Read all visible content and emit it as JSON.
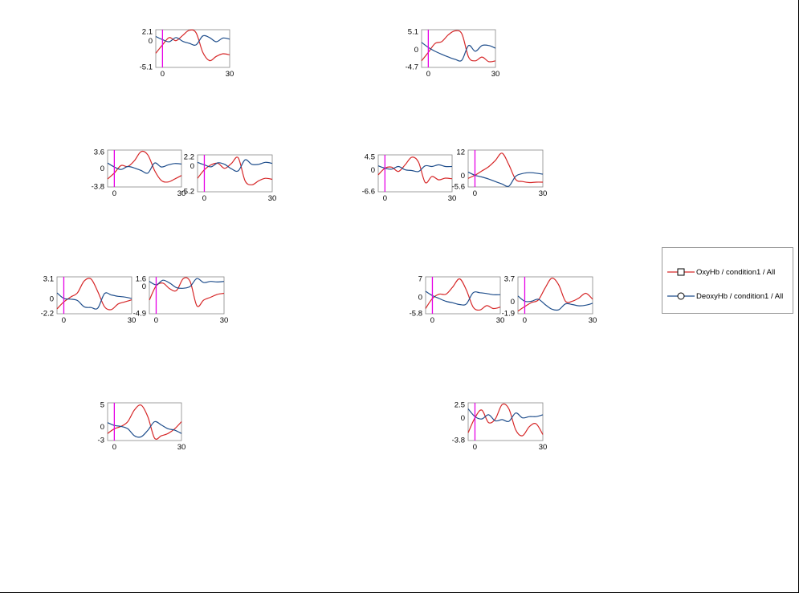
{
  "legend": {
    "placement": "right",
    "items": [
      {
        "label": "OxyHb / condition1 / All",
        "color": "#d62728",
        "marker": "square-icon"
      },
      {
        "label": "DeoxyHb / condition1 / All",
        "color": "#1f4e8c",
        "marker": "circle-icon"
      }
    ]
  },
  "colors": {
    "oxy": "#d62728",
    "deoxy": "#1f4e8c",
    "stim": "#e600e6"
  },
  "chart_data": [
    {
      "type": "line",
      "x_ticks": [
        "0",
        "30"
      ],
      "y_ticks": [
        "2.1",
        "0",
        "-5.1"
      ],
      "xlim": [
        -3,
        30
      ],
      "ylim": [
        -5.1,
        2.1
      ],
      "stim_x": 0,
      "series": [
        {
          "name": "OxyHb / condition1 / All",
          "x": [
            -3,
            0,
            3,
            6,
            9,
            12,
            15,
            18,
            21,
            24,
            27,
            30
          ],
          "y": [
            -2.4,
            -0.8,
            0.6,
            0.0,
            1.0,
            2.0,
            1.5,
            -2.2,
            -3.8,
            -3.0,
            -2.5,
            -2.7
          ]
        },
        {
          "name": "DeoxyHb / condition1 / All",
          "x": [
            -3,
            0,
            3,
            6,
            9,
            12,
            15,
            18,
            21,
            24,
            27,
            30
          ],
          "y": [
            0.8,
            0.2,
            -0.2,
            0.6,
            -0.1,
            -0.5,
            -0.8,
            0.9,
            0.6,
            -0.2,
            0.5,
            0.3
          ]
        }
      ]
    },
    {
      "type": "line",
      "x_ticks": [
        "0",
        "30"
      ],
      "y_ticks": [
        "5.1",
        "0",
        "-4.7"
      ],
      "xlim": [
        -3,
        30
      ],
      "ylim": [
        -4.7,
        5.1
      ],
      "stim_x": 0,
      "series": [
        {
          "name": "OxyHb / condition1 / All",
          "x": [
            -3,
            0,
            3,
            6,
            9,
            12,
            15,
            18,
            21,
            24,
            27,
            30
          ],
          "y": [
            -3.0,
            -0.8,
            1.5,
            2.0,
            3.8,
            4.8,
            4.0,
            -2.0,
            -3.0,
            -2.0,
            -3.2,
            -3.0
          ]
        },
        {
          "name": "DeoxyHb / condition1 / All",
          "x": [
            -3,
            0,
            3,
            6,
            9,
            12,
            15,
            18,
            21,
            24,
            27,
            30
          ],
          "y": [
            1.8,
            0.5,
            -0.5,
            -1.3,
            -2.0,
            -2.6,
            -2.8,
            1.0,
            -0.5,
            1.0,
            1.0,
            0.3
          ]
        }
      ]
    },
    {
      "type": "line",
      "x_ticks": [
        "0",
        "30"
      ],
      "y_ticks": [
        "3.6",
        "0",
        "-3.8"
      ],
      "xlim": [
        -3,
        30
      ],
      "ylim": [
        -3.8,
        3.6
      ],
      "stim_x": 0,
      "series": [
        {
          "name": "OxyHb / condition1 / All",
          "x": [
            -3,
            0,
            3,
            6,
            9,
            12,
            15,
            18,
            21,
            24,
            27,
            30
          ],
          "y": [
            -2.2,
            -1.0,
            0.5,
            0.3,
            1.5,
            3.3,
            2.6,
            -0.5,
            -2.5,
            -2.8,
            -2.2,
            -1.5
          ]
        },
        {
          "name": "DeoxyHb / condition1 / All",
          "x": [
            -3,
            0,
            3,
            6,
            9,
            12,
            15,
            18,
            21,
            24,
            27,
            30
          ],
          "y": [
            1.0,
            0.2,
            -0.3,
            0.3,
            0.0,
            -0.5,
            -1.0,
            1.0,
            0.2,
            0.6,
            0.9,
            0.8
          ]
        }
      ]
    },
    {
      "type": "line",
      "x_ticks": [
        "0",
        "30"
      ],
      "y_ticks": [
        "2.2",
        "0",
        "-5.2"
      ],
      "xlim": [
        -3,
        30
      ],
      "ylim": [
        -5.2,
        2.2
      ],
      "stim_x": 0,
      "series": [
        {
          "name": "OxyHb / condition1 / All",
          "x": [
            -3,
            0,
            3,
            6,
            9,
            12,
            15,
            18,
            21,
            24,
            27,
            30
          ],
          "y": [
            -2.5,
            -0.8,
            0.2,
            0.5,
            -0.5,
            0.5,
            1.6,
            -3.0,
            -3.8,
            -3.0,
            -2.5,
            -2.7
          ]
        },
        {
          "name": "DeoxyHb / condition1 / All",
          "x": [
            -3,
            0,
            3,
            6,
            9,
            12,
            15,
            18,
            21,
            24,
            27,
            30
          ],
          "y": [
            0.7,
            0.2,
            -0.2,
            0.6,
            0.3,
            -0.6,
            -1.0,
            1.2,
            0.3,
            0.3,
            0.7,
            0.5
          ]
        }
      ]
    },
    {
      "type": "line",
      "x_ticks": [
        "0",
        "30"
      ],
      "y_ticks": [
        "4.5",
        "0",
        "-6.6"
      ],
      "xlim": [
        -3,
        30
      ],
      "ylim": [
        -6.6,
        4.5
      ],
      "stim_x": 0,
      "series": [
        {
          "name": "OxyHb / condition1 / All",
          "x": [
            -3,
            0,
            3,
            6,
            9,
            12,
            15,
            18,
            21,
            24,
            27,
            30
          ],
          "y": [
            -1.5,
            0.5,
            0.8,
            -0.5,
            1.5,
            3.8,
            2.3,
            -3.8,
            -2.0,
            -3.0,
            -2.5,
            -2.7
          ]
        },
        {
          "name": "DeoxyHb / condition1 / All",
          "x": [
            -3,
            0,
            3,
            6,
            9,
            12,
            15,
            18,
            21,
            24,
            27,
            30
          ],
          "y": [
            1.2,
            0.5,
            0.2,
            1.0,
            0.0,
            -0.2,
            -0.5,
            1.2,
            1.0,
            1.5,
            1.0,
            1.0
          ]
        }
      ]
    },
    {
      "type": "line",
      "x_ticks": [
        "0",
        "30"
      ],
      "y_ticks": [
        "12",
        "0",
        "-5.6"
      ],
      "xlim": [
        -3,
        30
      ],
      "ylim": [
        -5.6,
        12
      ],
      "stim_x": 0,
      "series": [
        {
          "name": "OxyHb / condition1 / All",
          "x": [
            -3,
            0,
            3,
            6,
            9,
            12,
            15,
            18,
            21,
            24,
            27,
            30
          ],
          "y": [
            -1.5,
            0.0,
            2.0,
            4.0,
            7.0,
            10.5,
            5.0,
            -2.0,
            -3.0,
            -3.5,
            -3.3,
            -3.3
          ]
        },
        {
          "name": "DeoxyHb / condition1 / All",
          "x": [
            -3,
            0,
            3,
            6,
            9,
            12,
            15,
            18,
            21,
            24,
            27,
            30
          ],
          "y": [
            1.5,
            0.0,
            -0.8,
            -1.8,
            -3.0,
            -4.2,
            -5.2,
            -0.5,
            0.8,
            1.2,
            1.0,
            0.5
          ]
        }
      ]
    },
    {
      "type": "line",
      "x_ticks": [
        "0",
        "30"
      ],
      "y_ticks": [
        "3.1",
        "0",
        "-2.2"
      ],
      "xlim": [
        -3,
        30
      ],
      "ylim": [
        -2.2,
        3.1
      ],
      "stim_x": 0,
      "series": [
        {
          "name": "OxyHb / condition1 / All",
          "x": [
            -3,
            0,
            3,
            6,
            9,
            12,
            15,
            18,
            21,
            24,
            27,
            30
          ],
          "y": [
            -1.5,
            -0.5,
            0.2,
            0.8,
            2.5,
            2.8,
            1.0,
            -1.2,
            -1.6,
            -0.8,
            -0.5,
            -0.2
          ]
        },
        {
          "name": "DeoxyHb / condition1 / All",
          "x": [
            -3,
            0,
            3,
            6,
            9,
            12,
            15,
            18,
            21,
            24,
            27,
            30
          ],
          "y": [
            0.8,
            0.0,
            -0.1,
            -0.3,
            -1.2,
            -1.3,
            -1.4,
            0.7,
            0.5,
            0.3,
            0.2,
            0.0
          ]
        }
      ]
    },
    {
      "type": "line",
      "x_ticks": [
        "0",
        "30"
      ],
      "y_ticks": [
        "1.6",
        "0",
        "-4.9"
      ],
      "xlim": [
        -3,
        30
      ],
      "ylim": [
        -4.9,
        1.6
      ],
      "stim_x": 0,
      "series": [
        {
          "name": "OxyHb / condition1 / All",
          "x": [
            -3,
            0,
            3,
            6,
            9,
            12,
            15,
            18,
            21,
            24,
            27,
            30
          ],
          "y": [
            -2.5,
            0.0,
            0.5,
            -0.5,
            -0.8,
            1.3,
            0.8,
            -3.5,
            -2.5,
            -2.0,
            -1.5,
            -1.3
          ]
        },
        {
          "name": "DeoxyHb / condition1 / All",
          "x": [
            -3,
            0,
            3,
            6,
            9,
            12,
            15,
            18,
            21,
            24,
            27,
            30
          ],
          "y": [
            0.8,
            0.2,
            1.0,
            0.5,
            -0.3,
            -0.4,
            -0.1,
            1.3,
            0.6,
            0.8,
            0.7,
            0.8
          ]
        }
      ]
    },
    {
      "type": "line",
      "x_ticks": [
        "0",
        "30"
      ],
      "y_ticks": [
        "7",
        "0",
        "-5.8"
      ],
      "xlim": [
        -3,
        30
      ],
      "ylim": [
        -5.8,
        7
      ],
      "stim_x": 0,
      "series": [
        {
          "name": "OxyHb / condition1 / All",
          "x": [
            -3,
            0,
            3,
            6,
            9,
            12,
            15,
            18,
            21,
            24,
            27,
            30
          ],
          "y": [
            -4.0,
            -0.5,
            1.0,
            1.0,
            3.5,
            6.3,
            2.5,
            -3.5,
            -4.5,
            -3.0,
            -4.0,
            -3.5
          ]
        },
        {
          "name": "DeoxyHb / condition1 / All",
          "x": [
            -3,
            0,
            3,
            6,
            9,
            12,
            15,
            18,
            21,
            24,
            27,
            30
          ],
          "y": [
            2.0,
            0.5,
            -0.5,
            -1.5,
            -2.0,
            -2.6,
            -2.4,
            1.5,
            1.5,
            1.2,
            0.8,
            0.8
          ]
        }
      ]
    },
    {
      "type": "line",
      "x_ticks": [
        "0",
        "30"
      ],
      "y_ticks": [
        "3.7",
        "0",
        "-1.9"
      ],
      "xlim": [
        -3,
        30
      ],
      "ylim": [
        -1.9,
        3.7
      ],
      "stim_x": 0,
      "series": [
        {
          "name": "OxyHb / condition1 / All",
          "x": [
            -3,
            0,
            3,
            6,
            9,
            12,
            15,
            18,
            21,
            24,
            27,
            30
          ],
          "y": [
            -1.5,
            -0.8,
            -0.2,
            0.2,
            2.0,
            3.5,
            2.5,
            0.0,
            0.0,
            0.5,
            1.2,
            0.3
          ]
        },
        {
          "name": "DeoxyHb / condition1 / All",
          "x": [
            -3,
            0,
            3,
            6,
            9,
            12,
            15,
            18,
            21,
            24,
            27,
            30
          ],
          "y": [
            0.8,
            0.0,
            0.0,
            0.3,
            -0.5,
            -1.2,
            -1.3,
            -0.4,
            -0.5,
            -0.7,
            -0.6,
            -0.3
          ]
        }
      ]
    },
    {
      "type": "line",
      "x_ticks": [
        "0",
        "30"
      ],
      "y_ticks": [
        "5",
        "0",
        "-3"
      ],
      "xlim": [
        -3,
        30
      ],
      "ylim": [
        -3,
        5
      ],
      "stim_x": 0,
      "series": [
        {
          "name": "OxyHb / condition1 / All",
          "x": [
            -3,
            0,
            3,
            6,
            9,
            12,
            15,
            18,
            21,
            24,
            27,
            30
          ],
          "y": [
            -1.5,
            -0.5,
            0.0,
            1.0,
            3.5,
            4.5,
            2.0,
            -2.5,
            -2.0,
            -1.5,
            -0.5,
            1.0
          ]
        },
        {
          "name": "DeoxyHb / condition1 / All",
          "x": [
            -3,
            0,
            3,
            6,
            9,
            12,
            15,
            18,
            21,
            24,
            27,
            30
          ],
          "y": [
            0.8,
            0.2,
            0.0,
            -0.5,
            -2.0,
            -2.2,
            -0.8,
            1.0,
            0.3,
            -0.5,
            -0.8,
            -1.5
          ]
        }
      ]
    },
    {
      "type": "line",
      "x_ticks": [
        "0",
        "30"
      ],
      "y_ticks": [
        "2.5",
        "0",
        "-3.8"
      ],
      "xlim": [
        -3,
        30
      ],
      "ylim": [
        -3.8,
        2.5
      ],
      "stim_x": 0,
      "series": [
        {
          "name": "OxyHb / condition1 / All",
          "x": [
            -3,
            0,
            3,
            6,
            9,
            12,
            15,
            18,
            21,
            24,
            27,
            30
          ],
          "y": [
            -2.5,
            0.0,
            1.3,
            -0.8,
            -0.2,
            2.2,
            1.5,
            -2.0,
            -3.0,
            -1.5,
            -1.0,
            -2.8
          ]
        },
        {
          "name": "DeoxyHb / condition1 / All",
          "x": [
            -3,
            0,
            3,
            6,
            9,
            12,
            15,
            18,
            21,
            24,
            27,
            30
          ],
          "y": [
            1.5,
            0.2,
            -0.2,
            0.5,
            -0.5,
            -0.3,
            -0.6,
            0.8,
            0.0,
            0.2,
            0.2,
            0.5
          ]
        }
      ]
    }
  ]
}
